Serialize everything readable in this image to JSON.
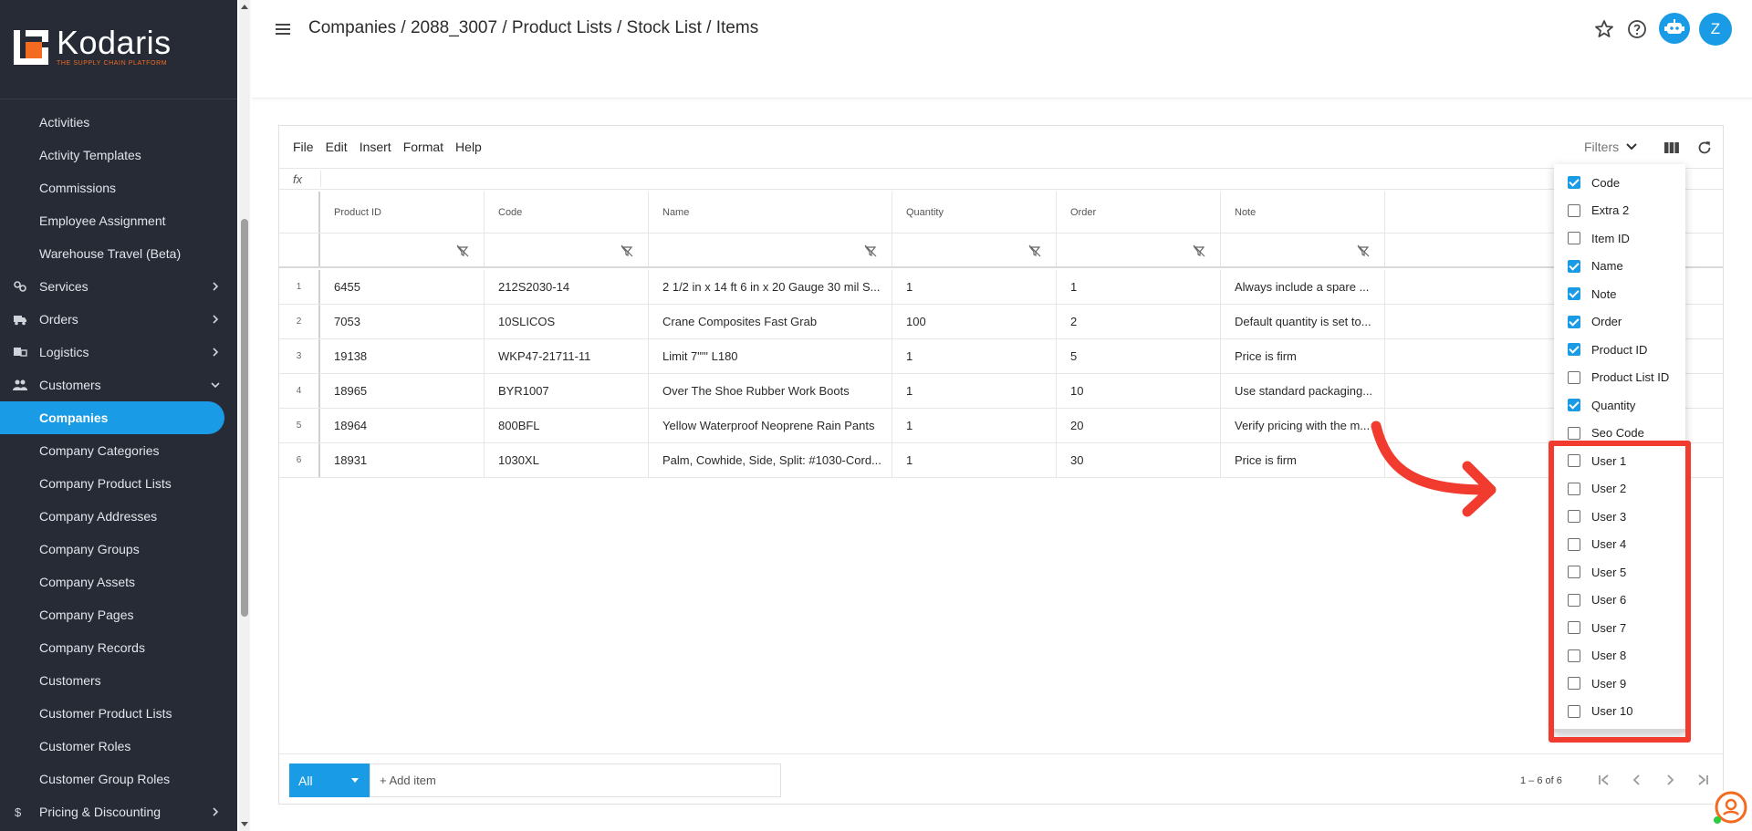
{
  "app": {
    "logo_name": "Kodaris",
    "logo_tagline": "THE SUPPLY CHAIN PLATFORM"
  },
  "sidebar": {
    "items": [
      {
        "label": "Activities",
        "type": "item"
      },
      {
        "label": "Activity Templates",
        "type": "item"
      },
      {
        "label": "Commissions",
        "type": "item"
      },
      {
        "label": "Employee Assignment",
        "type": "item"
      },
      {
        "label": "Warehouse Travel (Beta)",
        "type": "item"
      },
      {
        "label": "Services",
        "type": "group",
        "icon": "gears-icon",
        "expanded": false
      },
      {
        "label": "Orders",
        "type": "group",
        "icon": "truck-icon",
        "expanded": false
      },
      {
        "label": "Logistics",
        "type": "group",
        "icon": "shipping-icon",
        "expanded": false
      },
      {
        "label": "Customers",
        "type": "group",
        "icon": "people-icon",
        "expanded": true
      },
      {
        "label": "Companies",
        "type": "item",
        "active": true
      },
      {
        "label": "Company Categories",
        "type": "item"
      },
      {
        "label": "Company Product Lists",
        "type": "item"
      },
      {
        "label": "Company Addresses",
        "type": "item"
      },
      {
        "label": "Company Groups",
        "type": "item"
      },
      {
        "label": "Company Assets",
        "type": "item"
      },
      {
        "label": "Company Pages",
        "type": "item"
      },
      {
        "label": "Company Records",
        "type": "item"
      },
      {
        "label": "Customers",
        "type": "item"
      },
      {
        "label": "Customer Product Lists",
        "type": "item"
      },
      {
        "label": "Customer Roles",
        "type": "item"
      },
      {
        "label": "Customer Group Roles",
        "type": "item"
      },
      {
        "label": "Pricing & Discounting",
        "type": "group",
        "icon": "dollar-icon",
        "expanded": false
      }
    ]
  },
  "header": {
    "breadcrumb": "Companies / 2088_3007 / Product Lists / Stock List / Items",
    "avatar_initial": "Z"
  },
  "sheet": {
    "menu": [
      "File",
      "Edit",
      "Insert",
      "Format",
      "Help"
    ],
    "filters_label": "Filters",
    "fx_label": "fx",
    "columns": [
      "Product ID",
      "Code",
      "Name",
      "Quantity",
      "Order",
      "Note"
    ],
    "rows": [
      {
        "num": "1",
        "cells": [
          "6455",
          "212S2030-14",
          "2 1/2 in x 14 ft 6 in x 20 Gauge 30 mil S...",
          "1",
          "1",
          "Always include a spare ..."
        ]
      },
      {
        "num": "2",
        "cells": [
          "7053",
          "10SLICOS",
          "Crane Composites Fast Grab",
          "100",
          "2",
          "Default quantity is set to..."
        ]
      },
      {
        "num": "3",
        "cells": [
          "19138",
          "WKP47-21711-11",
          "Limit 7\"\"' L180",
          "1",
          "5",
          "Price is firm"
        ]
      },
      {
        "num": "4",
        "cells": [
          "18965",
          "BYR1007",
          "Over The Shoe Rubber Work Boots",
          "1",
          "10",
          "Use standard packaging..."
        ]
      },
      {
        "num": "5",
        "cells": [
          "18964",
          "800BFL",
          "Yellow Waterproof Neoprene Rain Pants",
          "1",
          "20",
          "Verify pricing with the m..."
        ]
      },
      {
        "num": "6",
        "cells": [
          "18931",
          "1030XL",
          "Palm, Cowhide, Side, Split: #1030-Cord...",
          "1",
          "30",
          "Price is firm"
        ]
      }
    ],
    "footer": {
      "scope": "All",
      "add_item": "+ Add item",
      "pager": "1 – 6 of 6"
    }
  },
  "column_chooser": {
    "items": [
      {
        "label": "Code",
        "checked": true
      },
      {
        "label": "Extra 2",
        "checked": false
      },
      {
        "label": "Item ID",
        "checked": false
      },
      {
        "label": "Name",
        "checked": true
      },
      {
        "label": "Note",
        "checked": true
      },
      {
        "label": "Order",
        "checked": true
      },
      {
        "label": "Product ID",
        "checked": true
      },
      {
        "label": "Product List ID",
        "checked": false
      },
      {
        "label": "Quantity",
        "checked": true
      },
      {
        "label": "Seo Code",
        "checked": false
      },
      {
        "label": "User 1",
        "checked": false
      },
      {
        "label": "User 2",
        "checked": false
      },
      {
        "label": "User 3",
        "checked": false
      },
      {
        "label": "User 4",
        "checked": false
      },
      {
        "label": "User 5",
        "checked": false
      },
      {
        "label": "User 6",
        "checked": false
      },
      {
        "label": "User 7",
        "checked": false
      },
      {
        "label": "User 8",
        "checked": false
      },
      {
        "label": "User 9",
        "checked": false
      },
      {
        "label": "User 10",
        "checked": false
      }
    ]
  },
  "colors": {
    "accent": "#1a9be6",
    "sidebar_bg": "#262b36",
    "highlight": "#f23b2f",
    "logo_orange": "#f26b21"
  }
}
